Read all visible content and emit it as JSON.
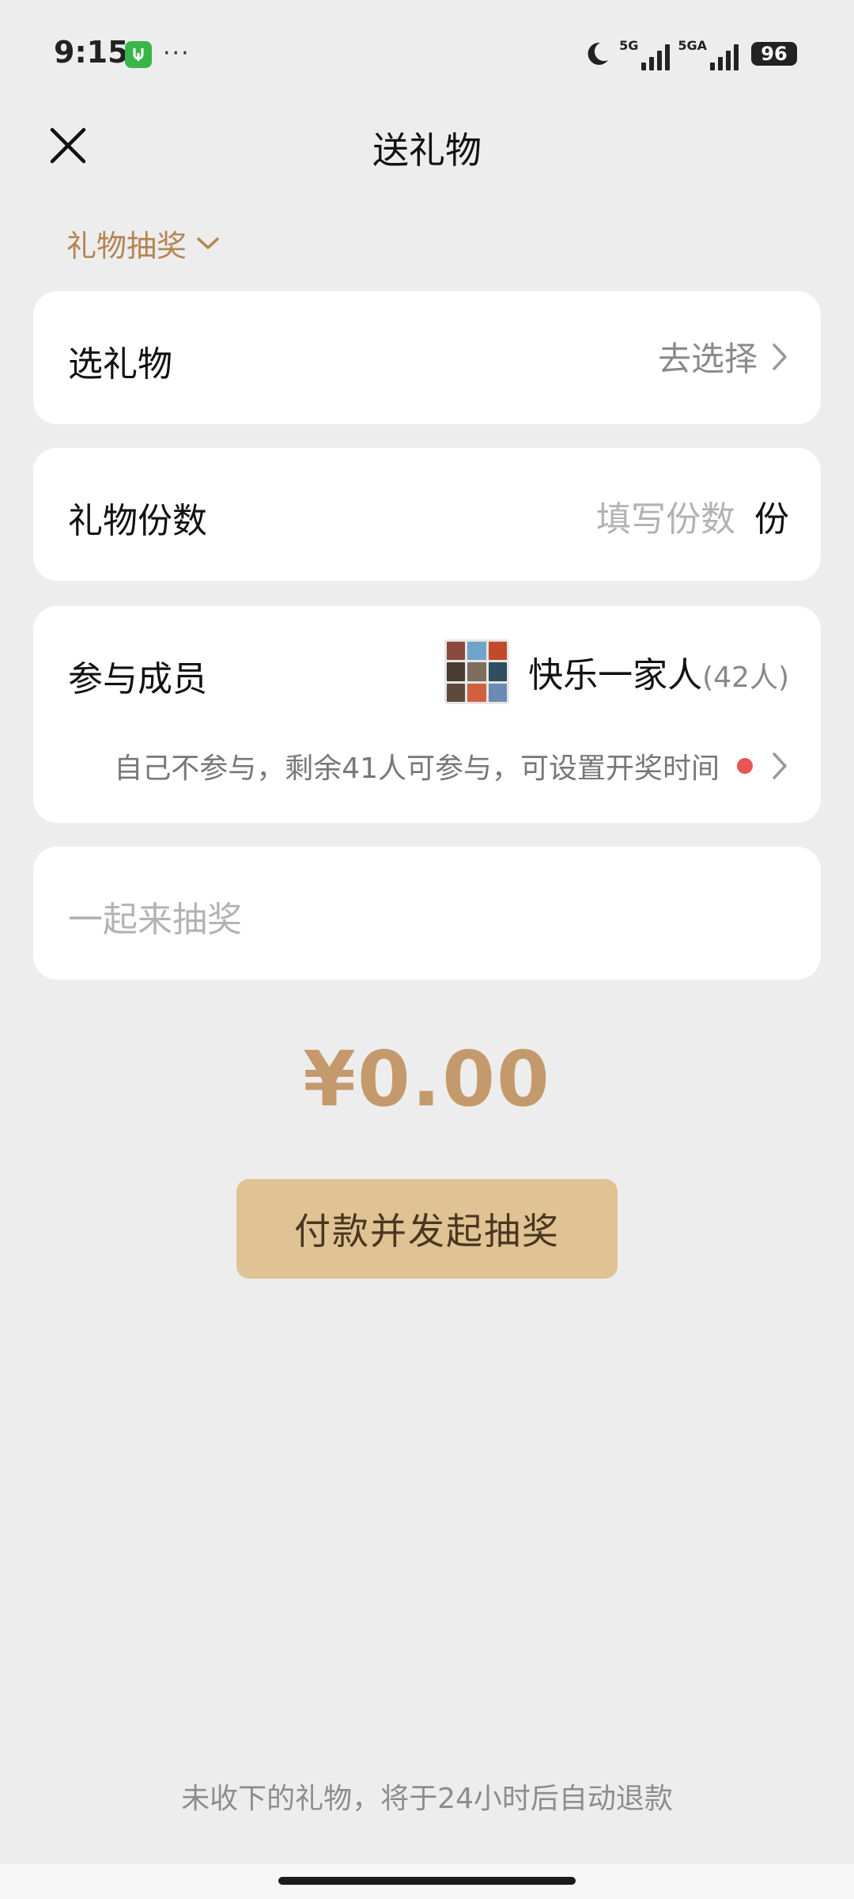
{
  "status_bar": {
    "time": "9:15",
    "dots": "···",
    "net1": "5G",
    "net2": "5GA",
    "battery": "96"
  },
  "header": {
    "title": "送礼物"
  },
  "mode": {
    "label": "礼物抽奖"
  },
  "gift_row": {
    "label": "选礼物",
    "action": "去选择"
  },
  "quantity_row": {
    "label": "礼物份数",
    "placeholder": "填写份数",
    "unit": "份"
  },
  "members_row": {
    "label": "参与成员",
    "group_name": "快乐一家人",
    "group_count": "(42人)",
    "hint": "自己不参与，剩余41人可参与，可设置开奖时间"
  },
  "message": {
    "placeholder": "一起来抽奖"
  },
  "amount": "¥0.00",
  "pay_button": "付款并发起抽奖",
  "footer_note": "未收下的礼物，将于24小时后自动退款",
  "colors": {
    "accent": "#b48552",
    "amount": "#c49a6c",
    "button": "#dfc394",
    "badge": "#e95454"
  }
}
